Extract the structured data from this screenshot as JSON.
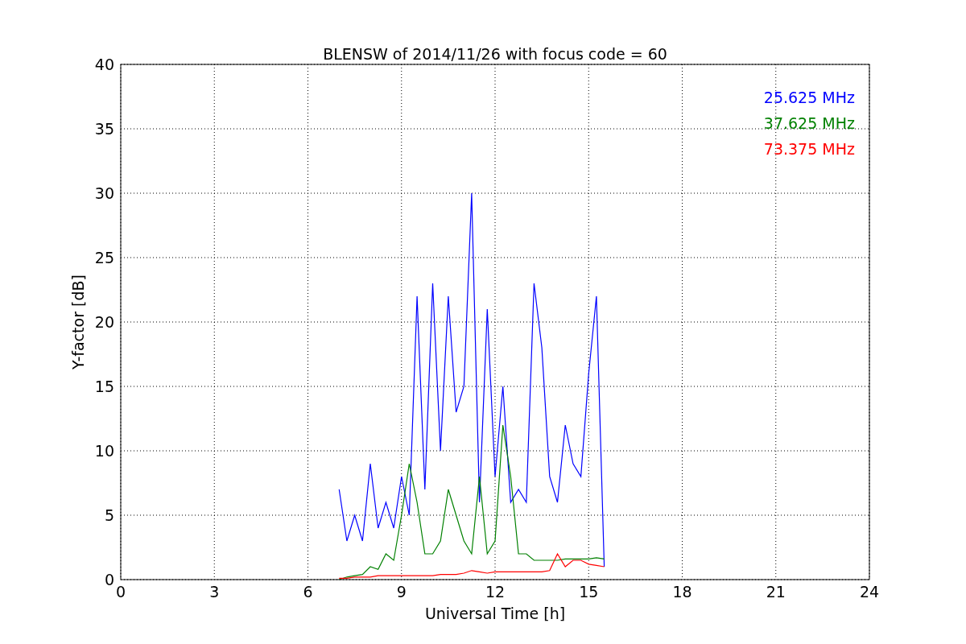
{
  "chart_data": {
    "type": "line",
    "title": "BLENSW of 2014/11/26 with focus code = 60",
    "xlabel": "Universal Time [h]",
    "ylabel": "Y-factor [dB]",
    "x": [
      7,
      7.25,
      7.5,
      7.75,
      8,
      8.25,
      8.5,
      8.75,
      9,
      9.25,
      9.5,
      9.75,
      10,
      10.25,
      10.5,
      10.75,
      11,
      11.25,
      11.5,
      11.75,
      12,
      12.25,
      12.5,
      12.75,
      13,
      13.25,
      13.5,
      13.75,
      14,
      14.25,
      14.5,
      14.75,
      15,
      15.25,
      15.5
    ],
    "grid": true,
    "xlim": [
      0,
      24
    ],
    "ylim": [
      0,
      40
    ],
    "xticks": [
      0,
      3,
      6,
      9,
      12,
      15,
      18,
      21,
      24
    ],
    "yticks": [
      0,
      5,
      10,
      15,
      20,
      25,
      30,
      35,
      40
    ],
    "series": [
      {
        "name": "25.625 MHz",
        "color": "#0000ff",
        "values": [
          7,
          3,
          5,
          3,
          9,
          4,
          6,
          4,
          8,
          5,
          22,
          7,
          23,
          10,
          22,
          13,
          15,
          30,
          6,
          21,
          8,
          15,
          6,
          7,
          6,
          23,
          18,
          8,
          6,
          12,
          9,
          8,
          16,
          22,
          1
        ]
      },
      {
        "name": "37.625 MHz",
        "color": "#008000",
        "values": [
          0,
          0.2,
          0.3,
          0.4,
          1,
          0.8,
          2,
          1.5,
          5,
          9,
          6,
          2,
          2,
          3,
          7,
          5,
          3,
          2,
          8,
          2,
          3,
          12,
          8,
          2,
          2,
          1.5,
          1.5,
          1.5,
          1.5,
          1.6,
          1.6,
          1.6,
          1.6,
          1.7,
          1.6
        ]
      },
      {
        "name": "73.375 MHz",
        "color": "#ff0000",
        "values": [
          0.1,
          0.1,
          0.2,
          0.2,
          0.2,
          0.3,
          0.3,
          0.3,
          0.3,
          0.3,
          0.3,
          0.3,
          0.3,
          0.4,
          0.4,
          0.4,
          0.5,
          0.7,
          0.6,
          0.5,
          0.6,
          0.6,
          0.6,
          0.6,
          0.6,
          0.6,
          0.6,
          0.7,
          2,
          1,
          1.5,
          1.5,
          1.2,
          1.1,
          1
        ]
      }
    ]
  }
}
